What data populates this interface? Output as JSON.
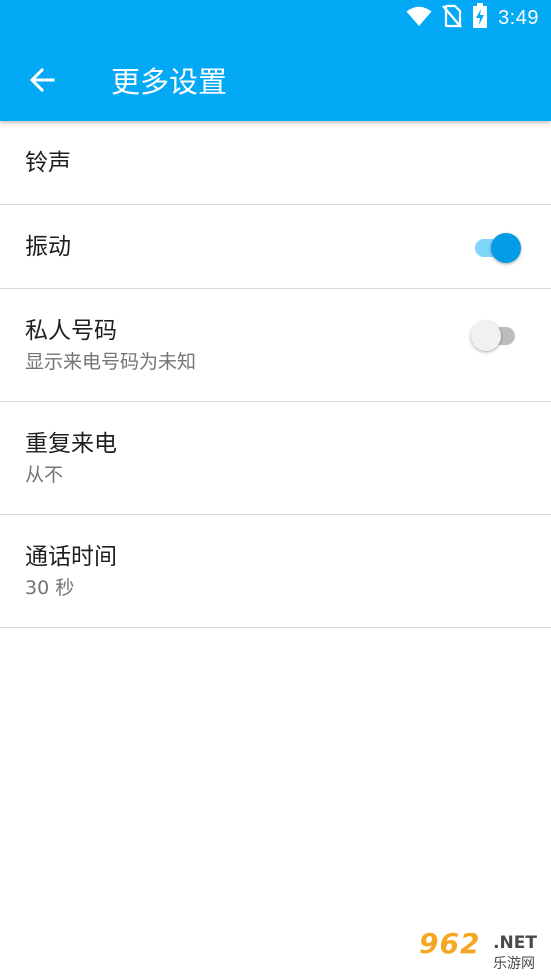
{
  "status_bar": {
    "time": "3:49",
    "icons": [
      "wifi-icon",
      "no-sim-icon",
      "battery-charging-icon"
    ]
  },
  "toolbar": {
    "back_icon": "arrow-back-icon",
    "title": "更多设置",
    "background_color": "#03a9f4"
  },
  "settings": {
    "ringtone": {
      "title": "铃声"
    },
    "vibrate": {
      "title": "振动",
      "enabled": true
    },
    "private_number": {
      "title": "私人号码",
      "subtitle": "显示来电号码为未知",
      "enabled": false
    },
    "repeat_call": {
      "title": "重复来电",
      "subtitle": "从不"
    },
    "call_duration": {
      "title": "通话时间",
      "subtitle": "30 秒"
    }
  },
  "colors": {
    "accent": "#039be5",
    "accent_track": "#81d4fa",
    "divider": "#d9d9d9",
    "secondary_text": "#757575"
  },
  "watermark": {
    "brand": "962",
    "domain": ".NET",
    "caption": "乐游网"
  }
}
